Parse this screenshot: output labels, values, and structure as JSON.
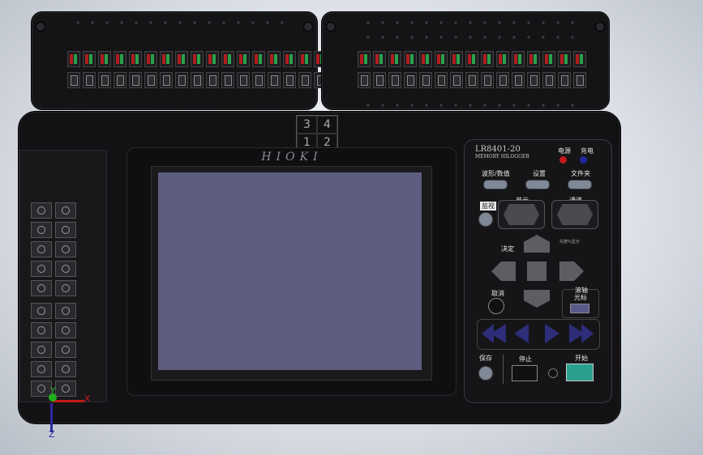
{
  "device": {
    "model": "LR8401-20",
    "subtitle": "MEMORY  HILOGGER",
    "brand": "HIOKI"
  },
  "unit_box": {
    "cells": [
      "3",
      "4",
      "1",
      "2"
    ]
  },
  "controls": {
    "power_label": "电源",
    "charge_label": "充电",
    "waveform_label": "波形/数值",
    "settings_label": "设置",
    "file_label": "文件夹",
    "monitor_label": "监视",
    "unit_label": "单元",
    "channel_label": "通道",
    "enter_label": "决定",
    "cancel_label": "取消",
    "scroll_label_1": "滚轴",
    "scroll_label_2": "光标",
    "save_label": "保存",
    "stop_label": "停止",
    "start_label": "开始",
    "small_note": "先按%显示"
  },
  "axes": {
    "x": "X",
    "y": "Y",
    "z": "Z"
  },
  "colors": {
    "power_led": "#c31a1a",
    "charge_led": "#1e2a9e",
    "screen": "#5d5d80",
    "start_button": "#2aa08f"
  }
}
